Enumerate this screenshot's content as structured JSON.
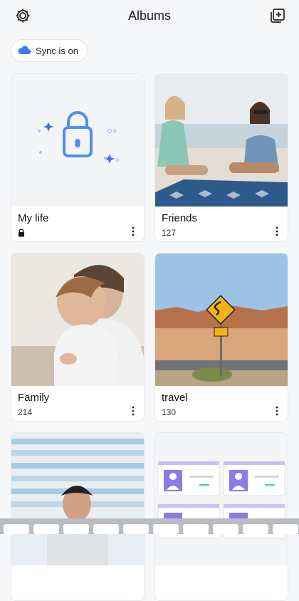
{
  "header": {
    "title": "Albums",
    "settings_icon": "gear-icon",
    "add_album_icon": "add-album-icon"
  },
  "sync": {
    "label": "Sync is on",
    "icon": "cloud-icon",
    "icon_color": "#3b7cf0"
  },
  "albums": [
    {
      "name": "My life",
      "count": "",
      "locked": true
    },
    {
      "name": "Friends",
      "count": "127"
    },
    {
      "name": "Family",
      "count": "214"
    },
    {
      "name": "travel",
      "count": "130"
    },
    {
      "name": "",
      "count": ""
    },
    {
      "name": "",
      "count": ""
    }
  ],
  "colors": {
    "accent": "#3b7cf0",
    "purple": "#8f79e8",
    "green": "#46d39a"
  }
}
